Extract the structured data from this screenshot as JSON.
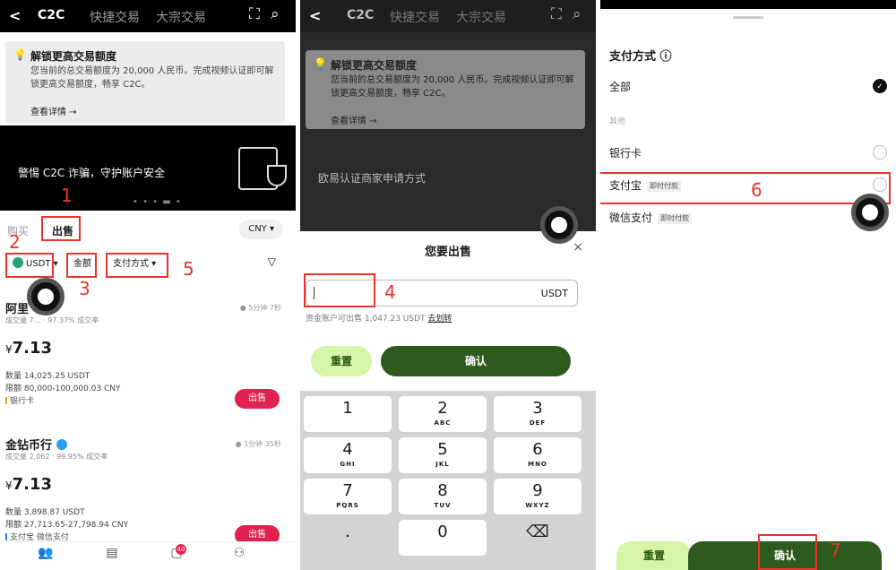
{
  "header": {
    "back": "<",
    "tabs": [
      "C2C",
      "快捷交易",
      "大宗交易"
    ],
    "scan_icon": "scan-icon",
    "search_icon": "search-icon"
  },
  "notice": {
    "title": "解锁更高交易额度",
    "desc": "您当前的总交易额度为 20,000 人民币。完成视频认证即可解锁更高交易额度，畅享 C2C。",
    "more": "查看详情 →"
  },
  "banner1": "警惕 C2C 诈骗，守护账户安全",
  "banner2": "欧易认证商家申请方式",
  "market": {
    "buy_tab": "购买",
    "sell_tab": "出售",
    "currency": "CNY ▾",
    "coin": "USDT",
    "amount_filter": "金额",
    "payment_filter": "支付方式 ▾"
  },
  "ads": [
    {
      "name": "阿里",
      "stats": "成交量 7… · 97.37% 成交率",
      "time": "5分钟 7秒",
      "currency_symbol": "¥",
      "price": "7.13",
      "qty": "数量 14,025.25 USDT",
      "limit": "限额 80,000-100,000.03 CNY",
      "methods": "银行卡",
      "button": "出售"
    },
    {
      "name": "金钻币行",
      "stats": "成交量 2,062 · 99.95% 成交率",
      "time": "1分钟 35秒",
      "currency_symbol": "¥",
      "price": "7.13",
      "qty": "数量 3,898.87 USDT",
      "limit": "限额 27,713.65-27,798.94 CNY",
      "methods": "支付宝  微信支付",
      "button": "出售"
    }
  ],
  "nav_badge": "40",
  "sell_sheet": {
    "title": "您要出售",
    "close": "×",
    "unit": "USDT",
    "available": "资金账户可出售 1,047.23 USDT",
    "transfer": "去划转",
    "reset": "重置",
    "confirm": "确认"
  },
  "keypad": [
    {
      "n": "1",
      "s": ""
    },
    {
      "n": "2",
      "s": "ABC"
    },
    {
      "n": "3",
      "s": "DEF"
    },
    {
      "n": "4",
      "s": "GHI"
    },
    {
      "n": "5",
      "s": "JKL"
    },
    {
      "n": "6",
      "s": "MNO"
    },
    {
      "n": "7",
      "s": "PQRS"
    },
    {
      "n": "8",
      "s": "TUV"
    },
    {
      "n": "9",
      "s": "WXYZ"
    },
    {
      "n": ".",
      "s": ""
    },
    {
      "n": "0",
      "s": ""
    },
    {
      "n": "⌫",
      "s": ""
    }
  ],
  "payment": {
    "title": "支付方式 ⓘ",
    "all": "全部",
    "other": "其他",
    "bank": "银行卡",
    "alipay": "支付宝",
    "wechat": "微信支付",
    "instant": "即时付款",
    "reset": "重置",
    "confirm": "确认"
  },
  "annotations": [
    "1",
    "2",
    "3",
    "4",
    "5",
    "6",
    "7"
  ],
  "colors": {
    "accent_red": "#e8342c",
    "sell_red": "#e0224e",
    "brand_green": "#2f5a1e",
    "light_green": "#d6f5a6"
  }
}
